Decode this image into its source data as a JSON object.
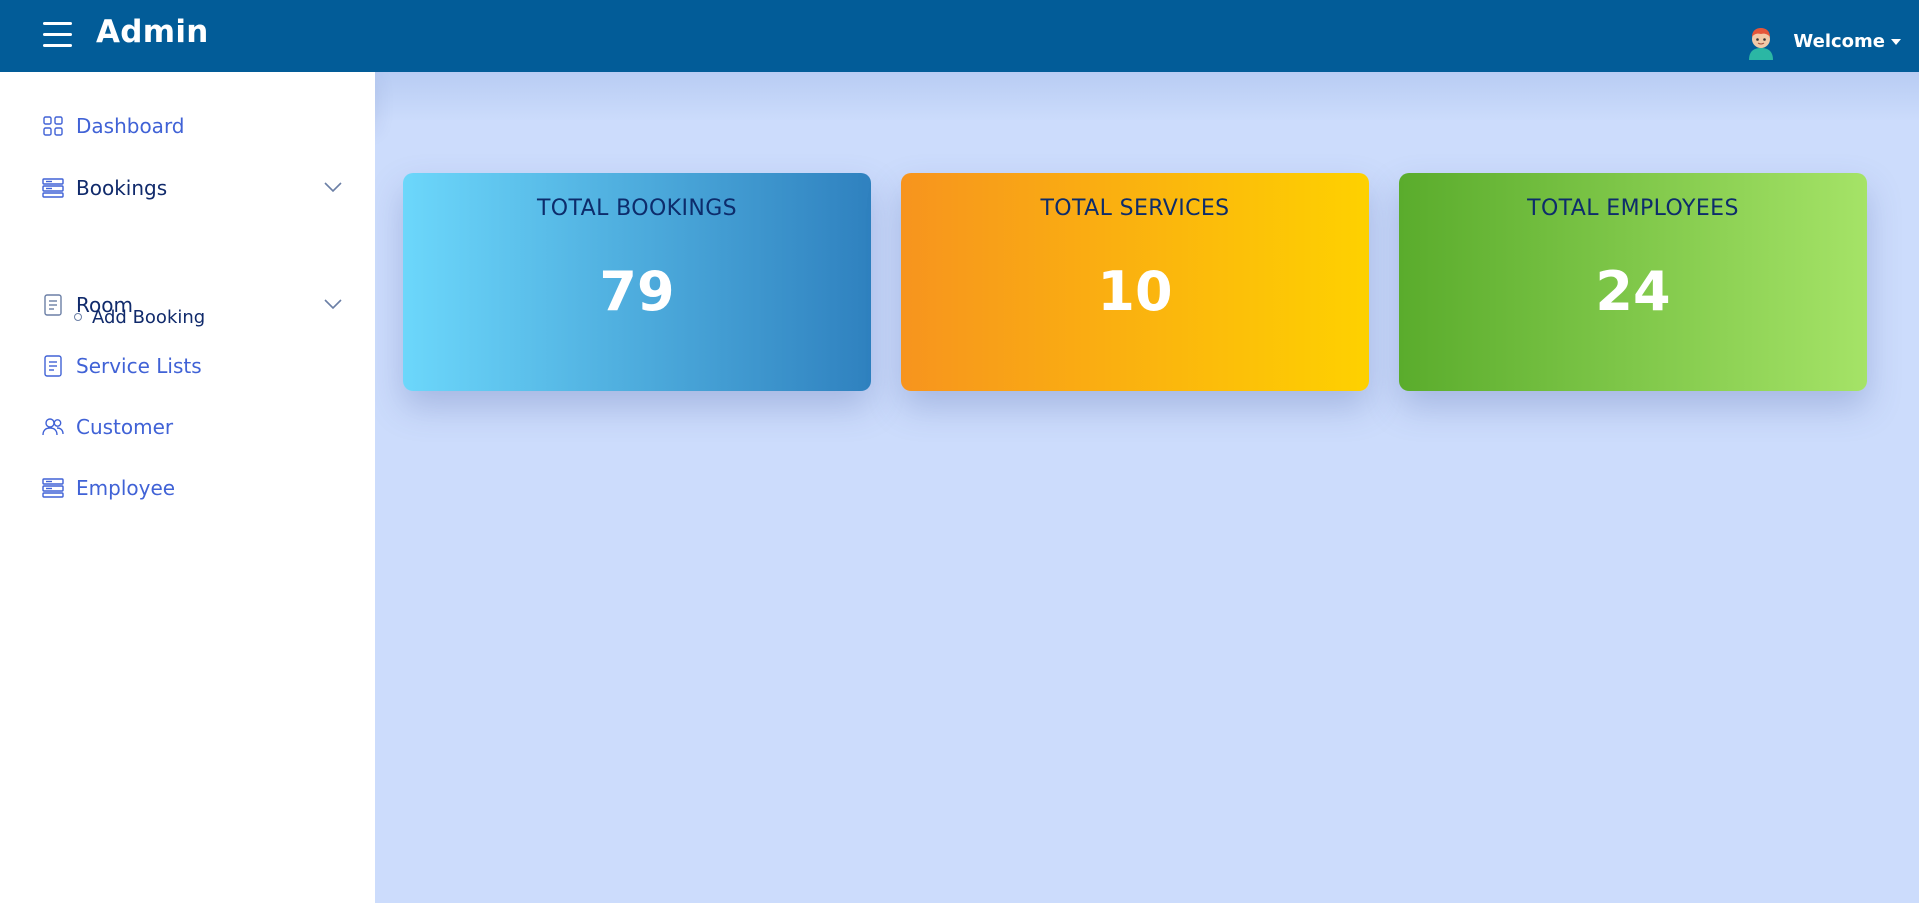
{
  "header": {
    "brand": "Admin",
    "user_label": "Welcome"
  },
  "sidebar": {
    "items": [
      {
        "label": "Dashboard",
        "icon": "grid-icon"
      },
      {
        "label": "Bookings",
        "icon": "list-icon",
        "expandable": true
      },
      {
        "label": "Room",
        "icon": "document-icon",
        "expandable": true
      },
      {
        "label": "Service Lists",
        "icon": "document-icon"
      },
      {
        "label": "Customer",
        "icon": "users-icon"
      },
      {
        "label": "Employee",
        "icon": "list-icon"
      }
    ],
    "bookings_subitems": [
      {
        "label": "Add Booking"
      }
    ]
  },
  "cards": [
    {
      "title": "TOTAL BOOKINGS",
      "value": "79",
      "colors": [
        "#6cd7fb",
        "#2f81bf"
      ]
    },
    {
      "title": "TOTAL SERVICES",
      "value": "10",
      "colors": [
        "#f7941e",
        "#fed100"
      ]
    },
    {
      "title": "TOTAL EMPLOYEES",
      "value": "24",
      "colors": [
        "#5aac2c",
        "#a5e367"
      ]
    }
  ],
  "colors": {
    "header": "#025c98",
    "content_bg": "#ccdcfc",
    "nav_active": "#4062d6",
    "nav_dark": "#102a6b"
  }
}
